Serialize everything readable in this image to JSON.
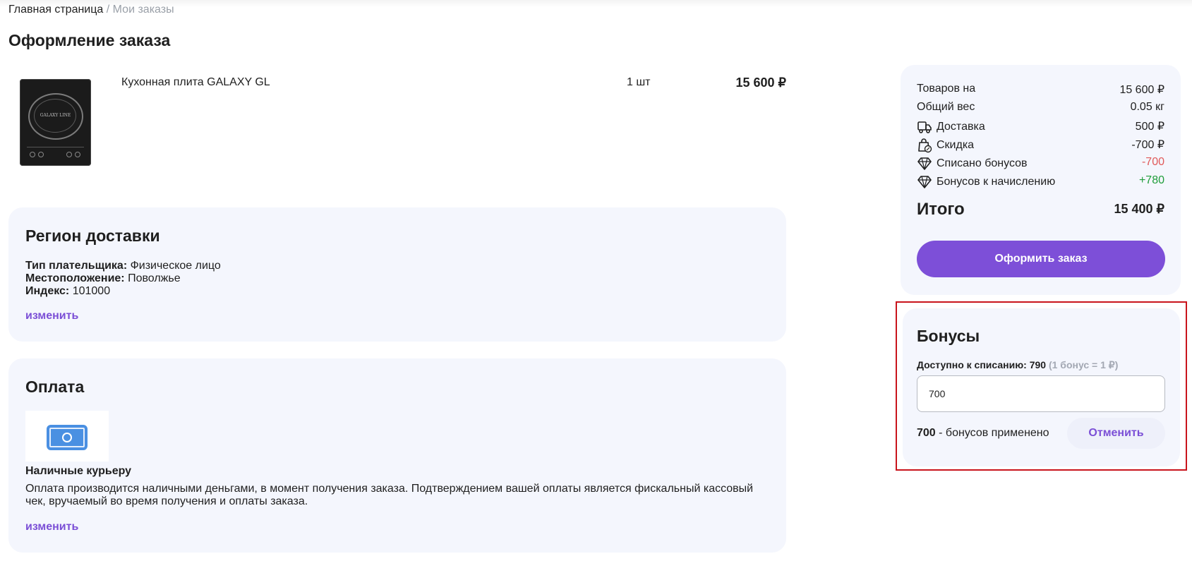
{
  "breadcrumb": {
    "home": "Главная страница",
    "separator": "/",
    "current": "Мои заказы"
  },
  "page_title": "Оформление заказа",
  "product": {
    "image_brand": "GALAXY LINE",
    "name": "Кухонная плита GALAXY GL",
    "qty": "1 шт",
    "price": "15 600 ₽"
  },
  "region": {
    "title": "Регион доставки",
    "payer_label": "Тип плательщика:",
    "payer_value": "Физическое лицо",
    "location_label": "Местоположение:",
    "location_value": "Поволжье",
    "index_label": "Индекс:",
    "index_value": "101000",
    "change": "изменить"
  },
  "payment": {
    "title": "Оплата",
    "method_icon": "cash-icon",
    "method": "Наличные курьеру",
    "description": "Оплата производится наличными деньгами, в момент получения заказа. Подтверждением вашей оплаты является фискальный кассовый чек, вручаемый во время получения и оплаты заказа.",
    "change": "изменить"
  },
  "summary": {
    "goods_label": "Товаров на",
    "goods_value": "15 600 ₽",
    "weight_label": "Общий вес",
    "weight_value": "0.05 кг",
    "delivery_label": "Доставка",
    "delivery_value": "500 ₽",
    "delivery_icon": "truck-icon",
    "discount_label": "Скидка",
    "discount_value": "-700 ₽",
    "discount_icon": "bag-percent-icon",
    "spent_label": "Списано бонусов",
    "spent_value": "-700",
    "spent_icon": "diamond-icon",
    "earn_label": "Бонусов к начислению",
    "earn_value": "+780",
    "earn_icon": "diamond-icon",
    "total_label": "Итого",
    "total_value": "15 400 ₽",
    "order_button": "Оформить заказ"
  },
  "bonuses": {
    "title": "Бонусы",
    "available_label": "Доступно к списанию: 790",
    "rate": "(1 бонус = 1 ₽)",
    "input_value": "700",
    "applied_amount": "700",
    "applied_text": " - бонусов применено",
    "cancel_button": "Отменить"
  },
  "colors": {
    "accent": "#7d4fd8",
    "card_bg": "#f4f6fd",
    "negative": "#e05a5a",
    "positive": "#1f9d3a",
    "highlight": "#c9141c"
  }
}
